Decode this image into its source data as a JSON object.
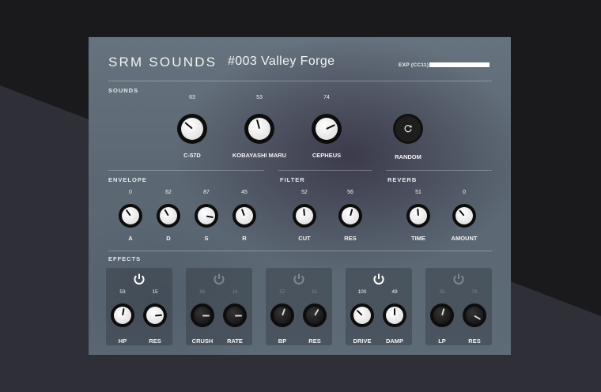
{
  "header": {
    "brand": "SRM SOUNDS",
    "patch": "#003  Valley Forge",
    "exp_label": "EXP (CC11)"
  },
  "sounds": {
    "title": "SOUNDS",
    "knobs": [
      {
        "label": "C-57D",
        "value": "63"
      },
      {
        "label": "KOBAYASHI MARU",
        "value": "53"
      },
      {
        "label": "CEPHEUS",
        "value": "74"
      }
    ],
    "random": {
      "label": "RANDOM",
      "icon": "refresh-icon"
    }
  },
  "envelope": {
    "title": "ENVELOPE",
    "knobs": [
      {
        "label": "A",
        "value": "0"
      },
      {
        "label": "D",
        "value": "62"
      },
      {
        "label": "S",
        "value": "87"
      },
      {
        "label": "R",
        "value": "45"
      }
    ]
  },
  "filter": {
    "title": "FILTER",
    "knobs": [
      {
        "label": "CUT",
        "value": "52"
      },
      {
        "label": "RES",
        "value": "56"
      }
    ]
  },
  "reverb": {
    "title": "REVERB",
    "knobs": [
      {
        "label": "TIME",
        "value": "51"
      },
      {
        "label": "AMOUNT",
        "value": "0"
      }
    ]
  },
  "effects": {
    "title": "EFFECTS",
    "units": [
      {
        "enabled": true,
        "knobs": [
          {
            "label": "HP",
            "value": "53"
          },
          {
            "label": "RES",
            "value": "15"
          }
        ]
      },
      {
        "enabled": false,
        "knobs": [
          {
            "label": "CRUSH",
            "value": "86"
          },
          {
            "label": "RATE",
            "value": "16"
          }
        ]
      },
      {
        "enabled": false,
        "knobs": [
          {
            "label": "BP",
            "value": "57"
          },
          {
            "label": "RES",
            "value": "61"
          }
        ]
      },
      {
        "enabled": true,
        "knobs": [
          {
            "label": "DRIVE",
            "value": "100"
          },
          {
            "label": "DAMP",
            "value": "49"
          }
        ]
      },
      {
        "enabled": false,
        "knobs": [
          {
            "label": "LP",
            "value": "35"
          },
          {
            "label": "RES",
            "value": "76"
          }
        ]
      }
    ]
  },
  "colors": {
    "panel": "#5f6b76",
    "knob_white": "#f2f2f2",
    "knob_black": "#0d0d0d",
    "page_dark": "#1b1b1d",
    "page_slate": "#2e2e35"
  }
}
